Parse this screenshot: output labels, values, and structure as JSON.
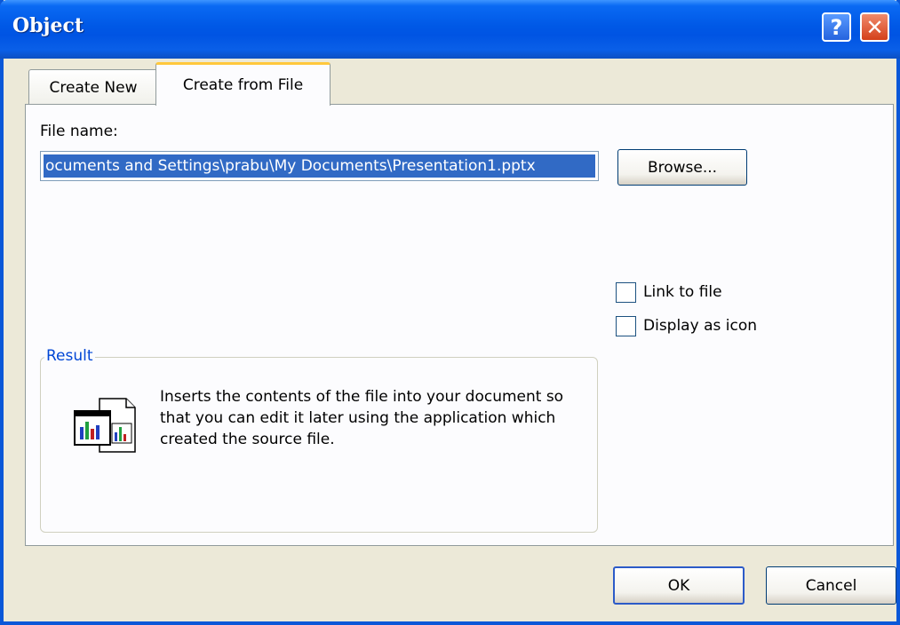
{
  "window": {
    "title": "Object"
  },
  "titlebar": {
    "help_label": "?",
    "close_label": "✕"
  },
  "tabs": [
    {
      "label": "Create New",
      "active": false
    },
    {
      "label": "Create from File",
      "active": true
    }
  ],
  "file": {
    "label": "File name:",
    "value": "ocuments and Settings\\prabu\\My Documents\\Presentation1.pptx",
    "browse_label": "Browse..."
  },
  "options": {
    "link_to_file": {
      "label": "Link to file",
      "checked": false
    },
    "display_as_icon": {
      "label": "Display as icon",
      "checked": false
    }
  },
  "result": {
    "legend": "Result",
    "description": "Inserts the contents of the file into your document so that you can edit it later using the application which created the source file.",
    "icon": "embed-object-icon"
  },
  "buttons": {
    "ok_label": "OK",
    "cancel_label": "Cancel"
  },
  "colors": {
    "title_blue": "#0054E3",
    "selection": "#316AC5",
    "tab_accent": "#FFC83C",
    "close_red": "#D4401A"
  }
}
